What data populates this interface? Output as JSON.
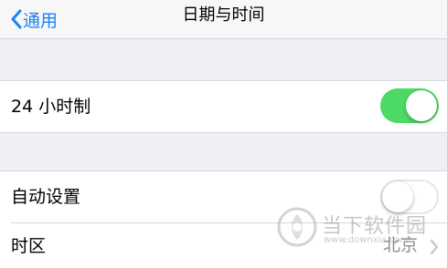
{
  "navbar": {
    "back_label": "通用",
    "title": "日期与时间"
  },
  "settings": {
    "hour24": {
      "label": "24 小时制",
      "enabled": true
    },
    "auto_set": {
      "label": "自动设置",
      "enabled": false
    },
    "timezone": {
      "label": "时区",
      "value": "北京"
    }
  },
  "colors": {
    "accent": "#1a82f7",
    "toggle_on": "#4cd964",
    "background": "#efeff4"
  },
  "watermark": {
    "brand_cn": "当下软件园",
    "domain": "www.downxia.com"
  }
}
